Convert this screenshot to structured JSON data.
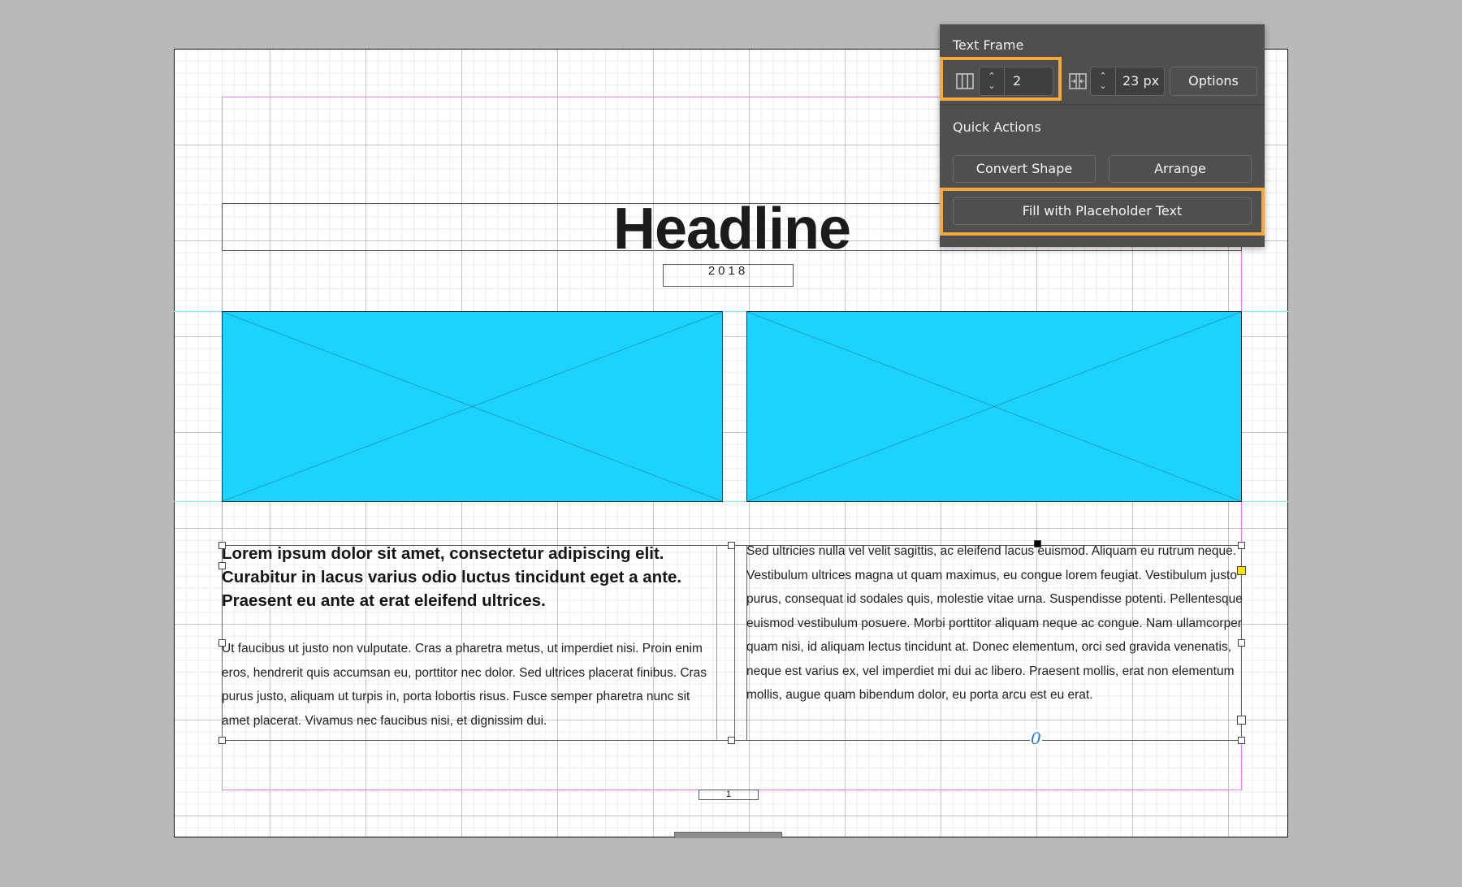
{
  "document": {
    "headline": "Headline",
    "year": "2018",
    "page_number": "1",
    "lead_paragraph": "Lorem ipsum dolor sit amet, consectetur adipiscing elit. Curabitur in lacus varius odio luctus tincidunt eget a ante. Praesent eu ante at erat eleifend ultrices.",
    "body_left": "Ut faucibus ut justo non vulputate. Cras a pharetra metus, ut imperdiet nisi. Proin enim eros, hendrerit quis accumsan eu, porttitor nec dolor. Sed ultrices placerat finibus. Cras purus justo, aliquam ut turpis in, porta lobortis risus. Fusce semper pharetra nunc sit amet placerat. Vivamus nec faucibus nisi, et dignissim dui.",
    "body_right": "Sed ultricies nulla vel velit sagittis, ac eleifend lacus euismod. Aliquam eu rutrum neque. Vestibulum ultrices magna ut quam maximus, eu congue lorem feugiat. Vestibulum justo purus, consequat id sodales quis, molestie vitae urna. Suspendisse potenti. Pellentesque euismod vestibulum posuere. Morbi porttitor aliquam neque ac congue. Nam ullamcorper quam nisi, id aliquam lectus tincidunt at. Donec elementum, orci sed gravida venenatis, neque est varius ex, vel imperdiet mi dui ac libero. Praesent mollis, erat non elementum mollis, augue quam bibendum dolor, eu porta arcu est eu erat.",
    "overflow_glyph": "0",
    "image_placeholder_color": "#1cd3ff"
  },
  "panel": {
    "text_frame_title": "Text Frame",
    "columns_icon": "columns-icon",
    "columns_value": "2",
    "gutter_icon": "gutter-icon",
    "gutter_value": "23 px",
    "options_label": "Options",
    "quick_actions_title": "Quick Actions",
    "convert_shape_label": "Convert Shape",
    "arrange_label": "Arrange",
    "fill_placeholder_label": "Fill with Placeholder Text",
    "stepper_up": "⌃",
    "stepper_down": "⌄",
    "highlight_color": "#f6a93b"
  }
}
